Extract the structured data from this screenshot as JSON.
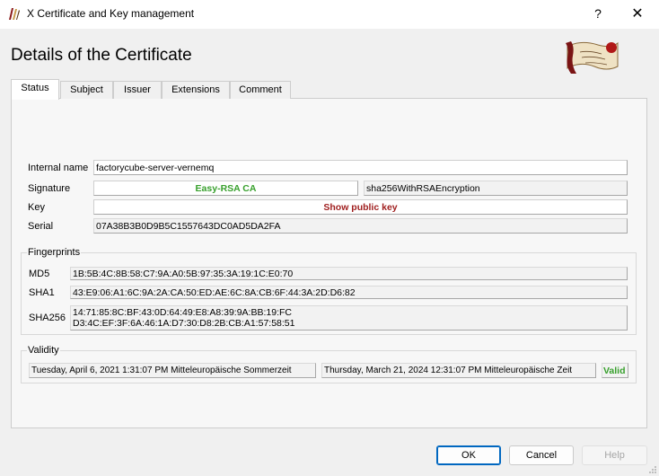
{
  "window": {
    "title": "X Certificate and Key management",
    "help_label": "?",
    "close_label": "✕"
  },
  "header": {
    "title": "Details of the Certificate"
  },
  "tabs": [
    {
      "label": "Status",
      "active": true
    },
    {
      "label": "Subject"
    },
    {
      "label": "Issuer"
    },
    {
      "label": "Extensions"
    },
    {
      "label": "Comment"
    }
  ],
  "status": {
    "internal_name_label": "Internal name",
    "internal_name_value": "factorycube-server-vernemq",
    "signature_label": "Signature",
    "signature_issuer": "Easy-RSA CA",
    "signature_algorithm": "sha256WithRSAEncryption",
    "key_label": "Key",
    "key_value": "Show public key",
    "serial_label": "Serial",
    "serial_value": "07A38B3B0D9B5C1557643DC0AD5DA2FA"
  },
  "fingerprints": {
    "title": "Fingerprints",
    "md5_label": "MD5",
    "md5_value": "1B:5B:4C:8B:58:C7:9A:A0:5B:97:35:3A:19:1C:E0:70",
    "sha1_label": "SHA1",
    "sha1_value": "43:E9:06:A1:6C:9A:2A:CA:50:ED:AE:6C:8A:CB:6F:44:3A:2D:D6:82",
    "sha256_label": "SHA256",
    "sha256_line1": "14:71:85:8C:BF:43:0D:64:49:E8:A8:39:9A:BB:19:FC",
    "sha256_line2": "D3:4C:EF:3F:6A:46:1A:D7:30:D8:2B:CB:A1:57:58:51"
  },
  "validity": {
    "title": "Validity",
    "not_before": "Tuesday, April 6, 2021 1:31:07 PM Mitteleuropäische Sommerzeit",
    "not_after": "Thursday, March 21, 2024 12:31:07 PM Mitteleuropäische Zeit",
    "status": "Valid"
  },
  "buttons": {
    "ok": "OK",
    "cancel": "Cancel",
    "help": "Help"
  },
  "colors": {
    "valid_green": "#37a02c",
    "key_red": "#a02020",
    "ok_border": "#0067c0"
  }
}
